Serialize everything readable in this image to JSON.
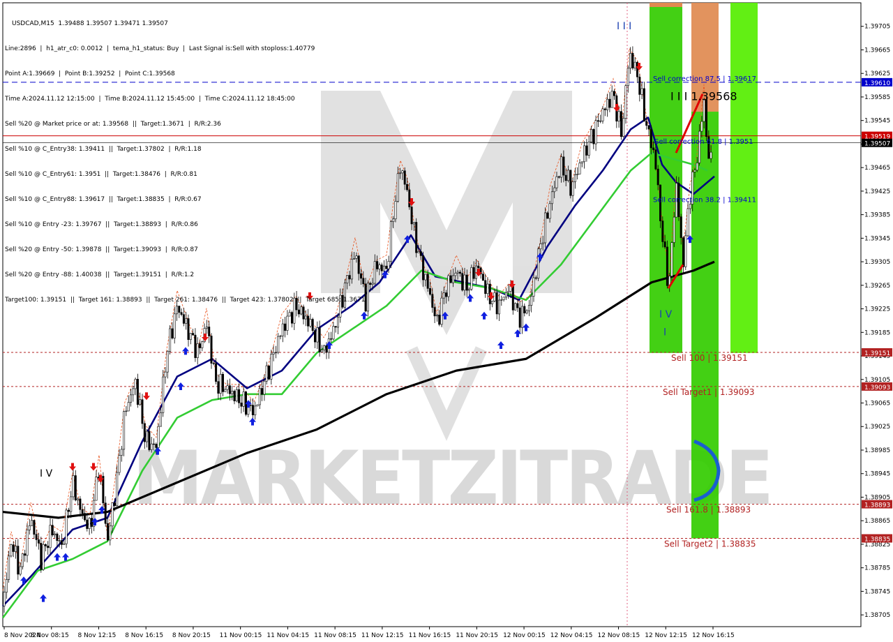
{
  "header": {
    "symbol_line": "USDCAD,M15  1.39488 1.39507 1.39471 1.39507",
    "lines": [
      "Line:2896  |  h1_atr_c0: 0.0012  |  tema_h1_status: Buy  |  Last Signal is:Sell with stoploss:1.40779",
      "Point A:1.39669  |  Point B:1.39252  |  Point C:1.39568",
      "Time A:2024.11.12 12:15:00  |  Time B:2024.11.12 15:45:00  |  Time C:2024.11.12 18:45:00",
      "Sell %20 @ Market price or at: 1.39568  ||  Target:1.3671  |  R/R:2.36",
      "Sell %10 @ C_Entry38: 1.39411  ||  Target:1.37802  |  R/R:1.18",
      "Sell %10 @ C_Entry61: 1.3951  ||  Target:1.38476  |  R/R:0.81",
      "Sell %10 @ C_Entry88: 1.39617  ||  Target:1.38835  |  R/R:0.67",
      "Sell %10 @ Entry -23: 1.39767  ||  Target:1.38893  |  R/R:0.86",
      "Sell %20 @ Entry -50: 1.39878  ||  Target:1.39093  |  R/R:0.87",
      "Sell %20 @ Entry -88: 1.40038  ||  Target:1.39151  |  R/R:1.2",
      "Target100: 1.39151  ||  Target 161: 1.38893  ||  Target 261: 1.38476  ||  Target 423: 1.37802  ||  Target 685: 1.3671"
    ]
  },
  "chart_data": {
    "type": "candlestick",
    "symbol": "USDCAD",
    "timeframe": "M15",
    "ylim": [
      1.38685,
      1.39745
    ],
    "y_ticks": [
      "1.39705",
      "1.39665",
      "1.39625",
      "1.39585",
      "1.39545",
      "1.39505",
      "1.39465",
      "1.39425",
      "1.39385",
      "1.39345",
      "1.39305",
      "1.39265",
      "1.39225",
      "1.39185",
      "1.39145",
      "1.39105",
      "1.39065",
      "1.39025",
      "1.38985",
      "1.38945",
      "1.38905",
      "1.38865",
      "1.38825",
      "1.38785",
      "1.38745",
      "1.38705"
    ],
    "x_ticks": [
      "8 Nov 2024",
      "8 Nov 08:15",
      "8 Nov 12:15",
      "8 Nov 16:15",
      "8 Nov 20:15",
      "11 Nov 00:15",
      "11 Nov 04:15",
      "11 Nov 08:15",
      "11 Nov 12:15",
      "11 Nov 16:15",
      "11 Nov 20:15",
      "12 Nov 00:15",
      "12 Nov 04:15",
      "12 Nov 08:15",
      "12 Nov 12:15",
      "12 Nov 16:15"
    ],
    "close_path": [
      [
        0,
        1.3872
      ],
      [
        12,
        1.3883
      ],
      [
        25,
        1.3878
      ],
      [
        40,
        1.3887
      ],
      [
        55,
        1.388
      ],
      [
        70,
        1.3885
      ],
      [
        85,
        1.3882
      ],
      [
        100,
        1.3893
      ],
      [
        112,
        1.3888
      ],
      [
        125,
        1.3885
      ],
      [
        138,
        1.3896
      ],
      [
        150,
        1.3883
      ],
      [
        162,
        1.3892
      ],
      [
        175,
        1.3905
      ],
      [
        190,
        1.391
      ],
      [
        205,
        1.39
      ],
      [
        220,
        1.3899
      ],
      [
        235,
        1.3915
      ],
      [
        250,
        1.3923
      ],
      [
        265,
        1.3919
      ],
      [
        280,
        1.3915
      ],
      [
        292,
        1.392
      ],
      [
        305,
        1.391
      ],
      [
        320,
        1.3909
      ],
      [
        340,
        1.3907
      ],
      [
        360,
        1.3905
      ],
      [
        380,
        1.3912
      ],
      [
        400,
        1.3919
      ],
      [
        420,
        1.3923
      ],
      [
        440,
        1.392
      ],
      [
        460,
        1.3915
      ],
      [
        475,
        1.3919
      ],
      [
        490,
        1.3926
      ],
      [
        505,
        1.3932
      ],
      [
        520,
        1.3924
      ],
      [
        535,
        1.393
      ],
      [
        550,
        1.3929
      ],
      [
        560,
        1.3939
      ],
      [
        570,
        1.3947
      ],
      [
        580,
        1.3942
      ],
      [
        590,
        1.3935
      ],
      [
        600,
        1.393
      ],
      [
        612,
        1.3925
      ],
      [
        622,
        1.392
      ],
      [
        635,
        1.3926
      ],
      [
        650,
        1.3929
      ],
      [
        665,
        1.3926
      ],
      [
        680,
        1.393
      ],
      [
        695,
        1.3925
      ],
      [
        710,
        1.3923
      ],
      [
        725,
        1.3926
      ],
      [
        740,
        1.3921
      ],
      [
        755,
        1.3923
      ],
      [
        770,
        1.3933
      ],
      [
        785,
        1.3941
      ],
      [
        800,
        1.3947
      ],
      [
        815,
        1.3943
      ],
      [
        830,
        1.3948
      ],
      [
        845,
        1.3952
      ],
      [
        860,
        1.3956
      ],
      [
        875,
        1.3959
      ],
      [
        887,
        1.3952
      ],
      [
        898,
        1.3966
      ],
      [
        910,
        1.3962
      ],
      [
        922,
        1.3954
      ],
      [
        935,
        1.3948
      ],
      [
        945,
        1.3935
      ],
      [
        955,
        1.3926
      ],
      [
        965,
        1.3944
      ],
      [
        975,
        1.393
      ],
      [
        985,
        1.3942
      ],
      [
        995,
        1.3948
      ],
      [
        1005,
        1.3958
      ],
      [
        1012,
        1.3947
      ],
      [
        1018,
        1.39507
      ]
    ],
    "series": [
      {
        "name": "",
        "color": "#000080",
        "values": [
          [
            0,
            1.3872
          ],
          [
            40,
            1.3877
          ],
          [
            100,
            1.3885
          ],
          [
            150,
            1.3887
          ],
          [
            200,
            1.39
          ],
          [
            250,
            1.3911
          ],
          [
            300,
            1.3914
          ],
          [
            350,
            1.3909
          ],
          [
            400,
            1.3912
          ],
          [
            450,
            1.3919
          ],
          [
            500,
            1.3923
          ],
          [
            540,
            1.3927
          ],
          [
            585,
            1.3935
          ],
          [
            620,
            1.3928
          ],
          [
            660,
            1.3927
          ],
          [
            700,
            1.3926
          ],
          [
            740,
            1.3924
          ],
          [
            780,
            1.3933
          ],
          [
            820,
            1.394
          ],
          [
            860,
            1.3946
          ],
          [
            900,
            1.3953
          ],
          [
            925,
            1.3955
          ],
          [
            945,
            1.3947
          ],
          [
            965,
            1.3944
          ],
          [
            990,
            1.3942
          ],
          [
            1020,
            1.3945
          ]
        ]
      },
      {
        "name": "",
        "color": "#33cc33",
        "values": [
          [
            0,
            1.387
          ],
          [
            50,
            1.3878
          ],
          [
            100,
            1.388
          ],
          [
            150,
            1.3883
          ],
          [
            200,
            1.3895
          ],
          [
            250,
            1.3904
          ],
          [
            300,
            1.3907
          ],
          [
            350,
            1.3908
          ],
          [
            400,
            1.3908
          ],
          [
            450,
            1.3915
          ],
          [
            500,
            1.3919
          ],
          [
            550,
            1.3923
          ],
          [
            600,
            1.3929
          ],
          [
            650,
            1.3927
          ],
          [
            700,
            1.3926
          ],
          [
            750,
            1.3924
          ],
          [
            800,
            1.393
          ],
          [
            850,
            1.3938
          ],
          [
            900,
            1.3946
          ],
          [
            930,
            1.3949
          ],
          [
            960,
            1.3948
          ],
          [
            990,
            1.3947
          ],
          [
            1010,
            1.3946
          ]
        ]
      },
      {
        "name": "",
        "color": "#000000",
        "values": [
          [
            0,
            1.3888
          ],
          [
            80,
            1.3887
          ],
          [
            150,
            1.3888
          ],
          [
            250,
            1.3893
          ],
          [
            350,
            1.3898
          ],
          [
            450,
            1.3902
          ],
          [
            550,
            1.3908
          ],
          [
            650,
            1.3912
          ],
          [
            750,
            1.3914
          ],
          [
            850,
            1.3921
          ],
          [
            930,
            1.3927
          ],
          [
            990,
            1.3929
          ],
          [
            1020,
            1.39305
          ]
        ]
      }
    ],
    "horizontal_lines": [
      {
        "value": 1.3961,
        "label": "1.39610",
        "style": "dashed",
        "color": "#0000cc"
      },
      {
        "value": 1.39519,
        "label": "1.39519",
        "style": "solid",
        "color": "#cc0000"
      },
      {
        "value": 1.39507,
        "label": "1.39507",
        "style": "solid-thin",
        "color": "#000000",
        "current": true
      },
      {
        "value": 1.39151,
        "label": "1.39151",
        "style": "dotted",
        "color": "#b22222"
      },
      {
        "value": 1.39093,
        "label": "1.39093",
        "style": "dotted",
        "color": "#b22222"
      },
      {
        "value": 1.38893,
        "label": "1.38893",
        "style": "dotted",
        "color": "#b22222"
      },
      {
        "value": 1.38835,
        "label": "1.38835",
        "style": "dotted",
        "color": "#b22222"
      }
    ],
    "level_labels": [
      {
        "text": "Sell correction 87.5 | 1.39617",
        "value": 1.39617,
        "color": "#0000cc"
      },
      {
        "text": "Sell correction 61.8 | 1.3951",
        "value": 1.3951,
        "color": "#0000cc"
      },
      {
        "text": "Sell correction 38.2 | 1.39411",
        "value": 1.39411,
        "color": "#0000cc"
      },
      {
        "text": "Sell 100 | 1.39151",
        "value": 1.39151,
        "color": "#b22222"
      },
      {
        "text": "Sell Target1 | 1.39093",
        "value": 1.39093,
        "color": "#b22222"
      },
      {
        "text": "Sell 161.8 | 1.38893",
        "value": 1.38893,
        "color": "#b22222"
      },
      {
        "text": "Sell Target2 | 1.38835",
        "value": 1.38835,
        "color": "#b22222"
      }
    ],
    "wave_labels": [
      {
        "text": "I I I 1.39568",
        "value": 1.39568
      },
      {
        "text": "I I I",
        "value": 1.397
      },
      {
        "text": "I V",
        "value": 1.3921
      },
      {
        "text": "I",
        "value": 1.3918
      },
      {
        "text": "I V",
        "value": 1.3894
      }
    ],
    "zones": [
      {
        "name": "green-zone-left",
        "color": "#33cc00",
        "from": 1.3915,
        "to": 1.39745
      },
      {
        "name": "orange-zone",
        "color": "#e08a50",
        "from": 1.3956,
        "to": 1.39745
      },
      {
        "name": "green-zone-tall",
        "color": "#33cc00",
        "from": 1.38835,
        "to": 1.3956
      },
      {
        "name": "green-zone-right",
        "color": "#55ee00",
        "from": 1.3915,
        "to": 1.39745
      }
    ],
    "watermark": "MARKETZITRADE"
  }
}
